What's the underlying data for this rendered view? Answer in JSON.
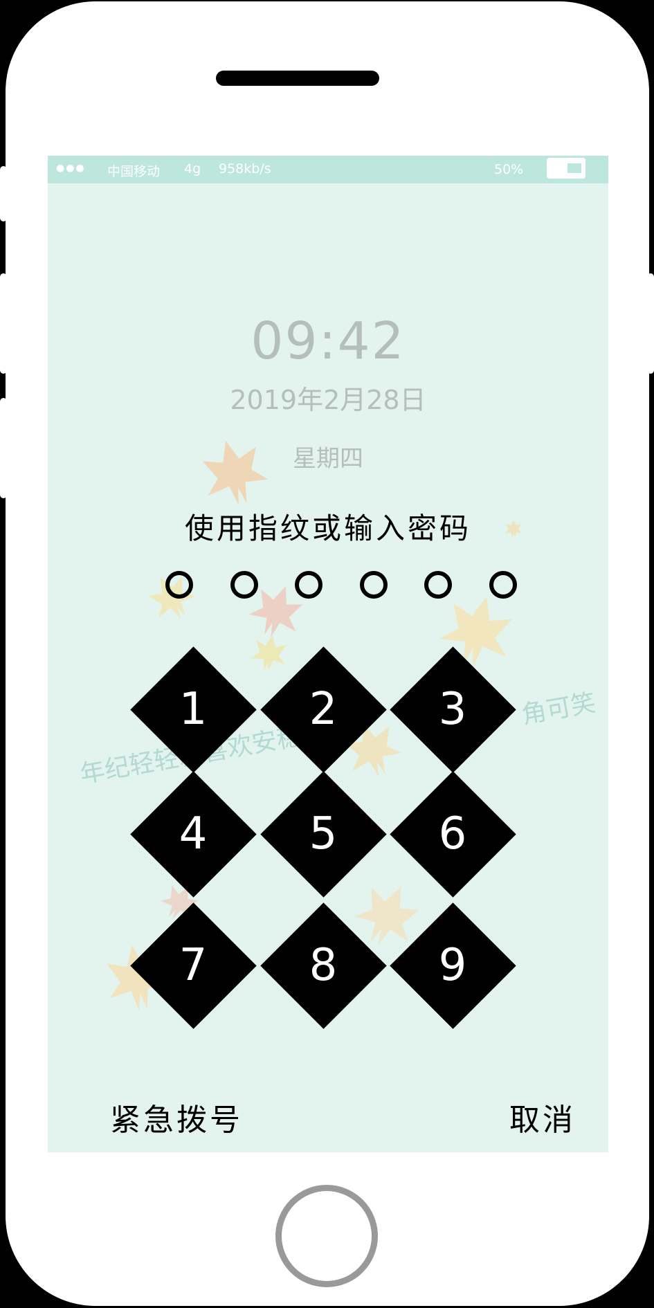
{
  "status_bar": {
    "signal": "●●●",
    "carrier": "中国移动",
    "network": "4g",
    "speed": "958kb/s",
    "battery_percent": "50%",
    "battery_level": 0.5
  },
  "lock_screen": {
    "time": "09:42",
    "date": "2019年2月28日",
    "weekday": "星期四",
    "wallpaper_text_1": "年纪轻轻就喜欢安稳,",
    "wallpaper_text_2": "角可笑"
  },
  "passcode": {
    "prompt": "使用指纹或输入密码",
    "digits_total": 6,
    "digits_entered": 0
  },
  "keypad": {
    "keys": [
      "1",
      "2",
      "3",
      "4",
      "5",
      "6",
      "7",
      "8",
      "9"
    ]
  },
  "actions": {
    "emergency": "紧急拨号",
    "cancel": "取消"
  },
  "colors": {
    "screen_bg": "#e3f4ef",
    "status_bar_bg": "#bde7dd",
    "key_bg": "#000000",
    "muted_text": "#b4bebb"
  }
}
